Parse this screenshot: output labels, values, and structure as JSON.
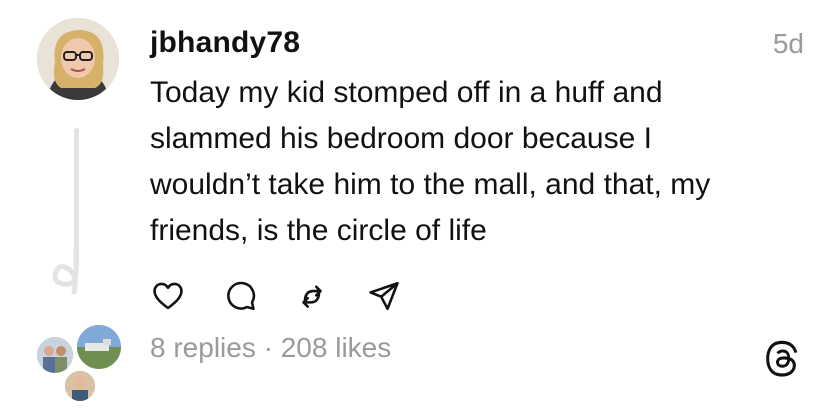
{
  "post": {
    "username": "jbhandy78",
    "time": "5d",
    "text": "Today my kid stomped off in a huff and\nslammed his bedroom door because I\nwouldn’t take him to the mall, and that, my\nfriends, is the circle of life"
  },
  "actions": [
    {
      "icon": "heart-icon"
    },
    {
      "icon": "comment-icon"
    },
    {
      "icon": "repost-icon"
    },
    {
      "icon": "share-icon"
    }
  ],
  "stats": {
    "replies": "8 replies",
    "separator": " · ",
    "likes": "208 likes"
  },
  "colors": {
    "text": "#111111",
    "muted": "#9a9a9a",
    "thread_line": "#e3e3e3"
  }
}
